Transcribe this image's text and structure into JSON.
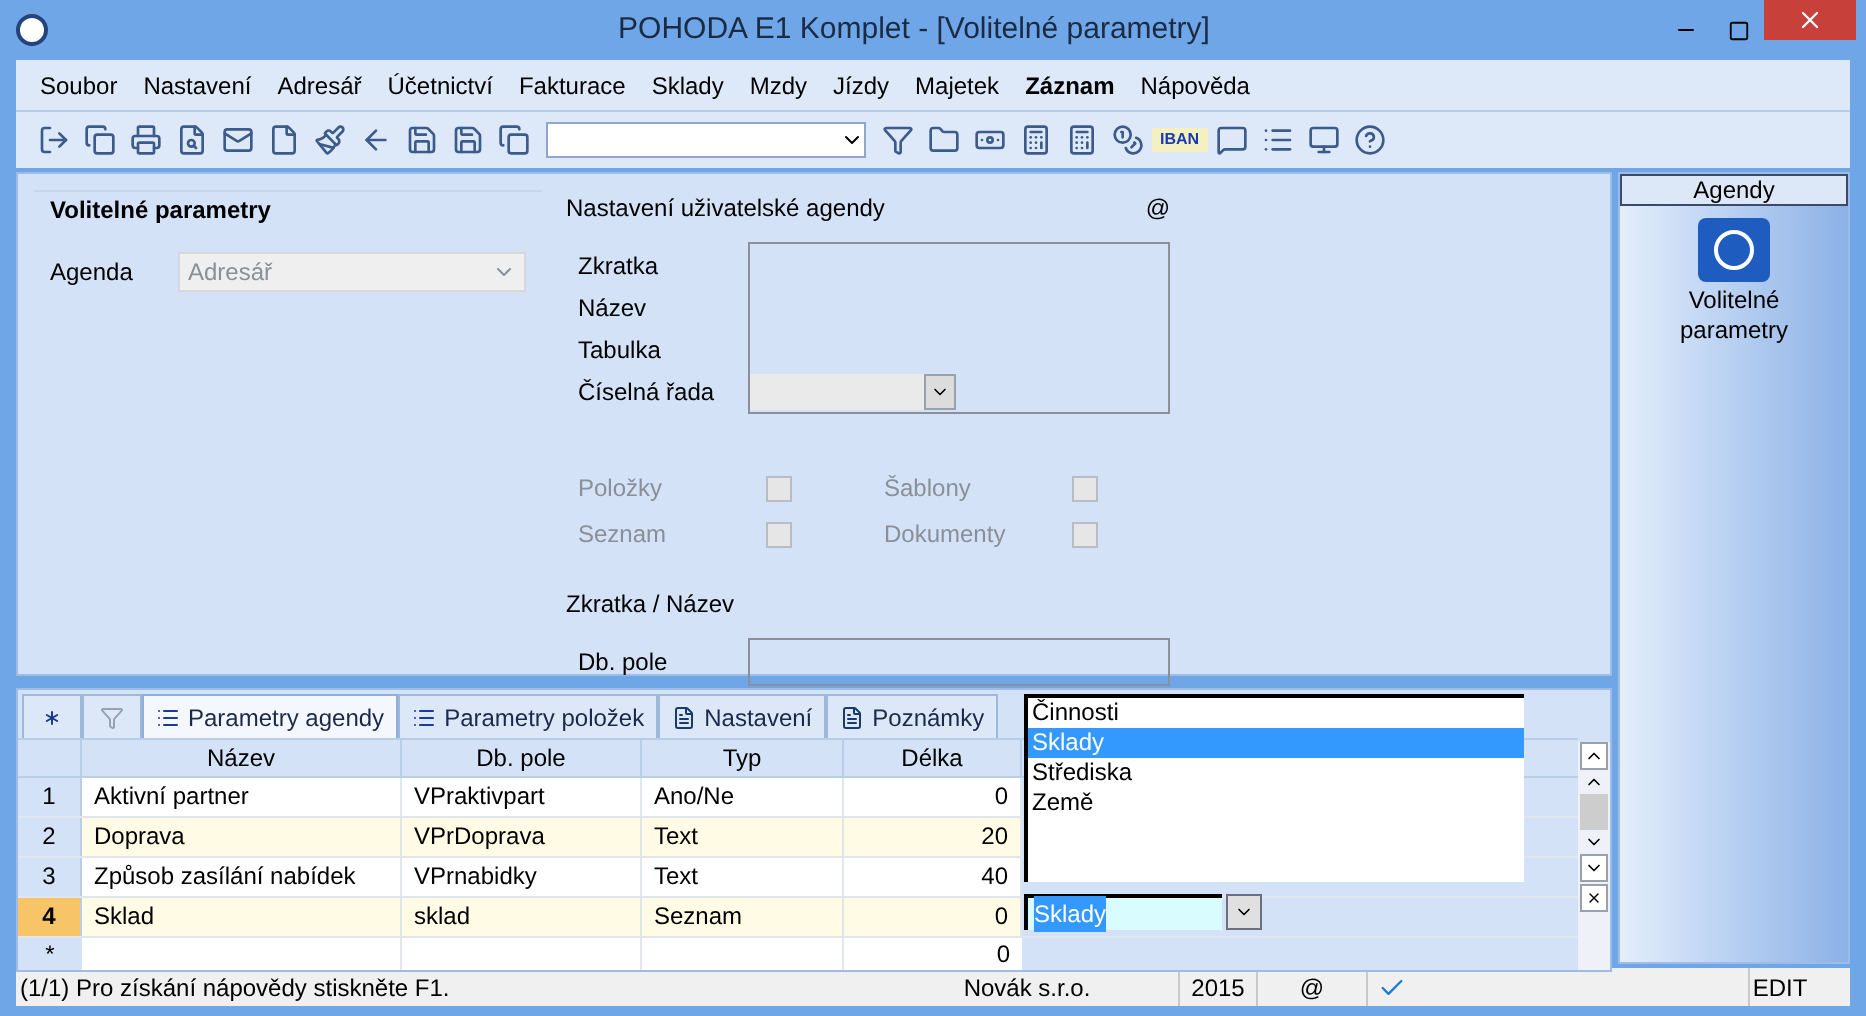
{
  "window": {
    "title": "POHODA E1 Komplet - [Volitelné parametry]"
  },
  "menu": [
    {
      "label": "Soubor",
      "bold": false
    },
    {
      "label": "Nastavení",
      "bold": false
    },
    {
      "label": "Adresář",
      "bold": false
    },
    {
      "label": "Účetnictví",
      "bold": false
    },
    {
      "label": "Fakturace",
      "bold": false
    },
    {
      "label": "Sklady",
      "bold": false
    },
    {
      "label": "Mzdy",
      "bold": false
    },
    {
      "label": "Jízdy",
      "bold": false
    },
    {
      "label": "Majetek",
      "bold": false
    },
    {
      "label": "Záznam",
      "bold": true
    },
    {
      "label": "Nápověda",
      "bold": false
    }
  ],
  "toolbar": {
    "iban_label": "IBAN"
  },
  "form": {
    "title": "Volitelné parametry",
    "agenda_label": "Agenda",
    "agenda_value": "Adresář",
    "agenda_disabled": true,
    "section_title": "Nastavení uživatelské agendy",
    "section_mark": "@",
    "fields": [
      "Zkratka",
      "Název",
      "Tabulka",
      "Číselná řada"
    ],
    "checkboxes": [
      {
        "label": "Položky",
        "checked": false,
        "disabled": true
      },
      {
        "label": "Seznam",
        "checked": false,
        "disabled": true
      },
      {
        "label": "Šablony",
        "checked": false,
        "disabled": true
      },
      {
        "label": "Dokumenty",
        "checked": false,
        "disabled": true
      }
    ],
    "group_title": "Zkratka / Název",
    "db_label": "Db. pole"
  },
  "sidebar": {
    "header": "Agendy",
    "items": [
      {
        "label": "Volitelné parametry",
        "selected": false
      }
    ]
  },
  "tabs": [
    {
      "kind": "new",
      "selected": false
    },
    {
      "kind": "filter",
      "selected": false
    },
    {
      "kind": "label",
      "label": "Parametry agendy",
      "selected": true
    },
    {
      "kind": "label",
      "label": "Parametry položek",
      "selected": false
    },
    {
      "kind": "label",
      "label": "Nastavení",
      "selected": false
    },
    {
      "kind": "label",
      "label": "Poznámky",
      "selected": false
    }
  ],
  "table": {
    "columns": [
      "Název",
      "Db. pole",
      "Typ",
      "Délka"
    ],
    "rows": [
      {
        "number": "1",
        "cells": [
          "Aktivní partner",
          "VPraktivpart",
          "Ano/Ne",
          "0"
        ],
        "selected": false
      },
      {
        "number": "2",
        "cells": [
          "Doprava",
          "VPrDoprava",
          "Text",
          "20"
        ],
        "selected": false
      },
      {
        "number": "3",
        "cells": [
          "Způsob zasílání nabídek",
          "VPrnabidky",
          "Text",
          "40"
        ],
        "selected": false
      },
      {
        "number": "4",
        "cells": [
          "Sklad",
          "sklad",
          "Seznam",
          "0"
        ],
        "selected": true
      }
    ],
    "new_row": {
      "number": "*",
      "length": "0"
    }
  },
  "dropdown": {
    "options": [
      {
        "label": "Činnosti",
        "selected": false
      },
      {
        "label": "Sklady",
        "selected": true
      },
      {
        "label": "Střediska",
        "selected": false
      },
      {
        "label": "Země",
        "selected": false
      }
    ],
    "value": "Sklady"
  },
  "status_bar": {
    "help": "(1/1) Pro získání nápovědy stiskněte F1.",
    "company": "Novák s.r.o.",
    "year": "2015",
    "mark": "@",
    "mode": "EDIT"
  }
}
